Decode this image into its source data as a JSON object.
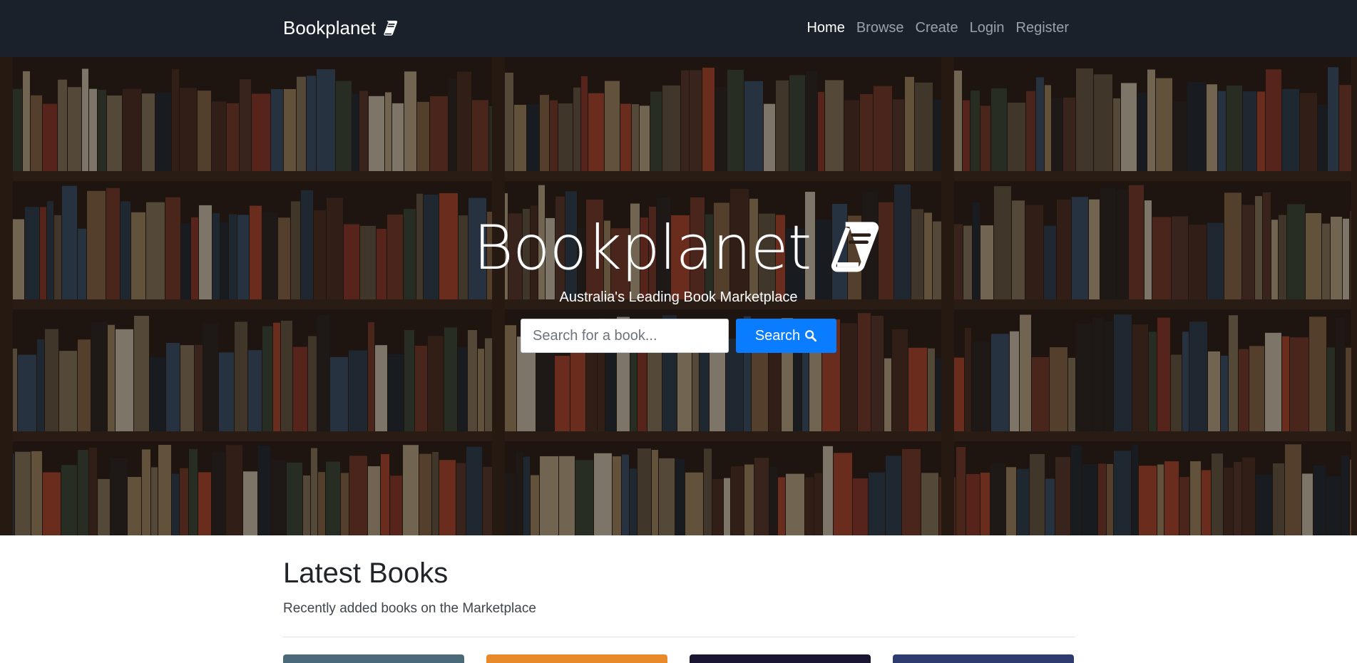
{
  "navbar": {
    "brand": "Bookplanet",
    "brand_icon": "book-icon",
    "links": [
      {
        "label": "Home",
        "active": true
      },
      {
        "label": "Browse",
        "active": false
      },
      {
        "label": "Create",
        "active": false
      },
      {
        "label": "Login",
        "active": false
      },
      {
        "label": "Register",
        "active": false
      }
    ]
  },
  "hero": {
    "title": "Bookplanet",
    "title_icon": "book-icon",
    "subtitle": "Australia's Leading Book Marketplace",
    "search": {
      "placeholder": "Search for a book...",
      "value": "",
      "button_label": "Search",
      "button_icon": "search-icon"
    }
  },
  "latest": {
    "title": "Latest Books",
    "subtitle": "Recently added books on the Marketplace",
    "card_colors": [
      "#4a6a7a",
      "#e8892a",
      "#1a1530",
      "#2e3b6e"
    ]
  },
  "colors": {
    "navbar_bg": "#1b212b",
    "primary": "#0a7cff"
  }
}
